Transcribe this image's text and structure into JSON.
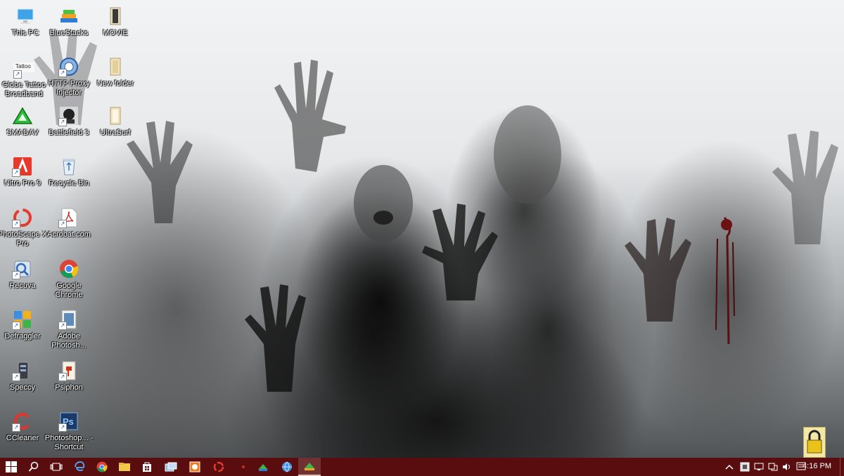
{
  "desktop": {
    "icons": [
      {
        "id": "this-pc",
        "label": "This PC",
        "icon": "monitor-icon"
      },
      {
        "id": "globe-tattoo",
        "label": "Globe Tattoo Broadband",
        "icon": "tattoo-icon",
        "badge": "Tattoo"
      },
      {
        "id": "smadav",
        "label": "SMADAV",
        "icon": "smadav-icon"
      },
      {
        "id": "nitro",
        "label": "Nitro Pro 9",
        "icon": "nitro-icon"
      },
      {
        "id": "photoscape",
        "label": "PhotoScape X Pro",
        "icon": "photoscape-icon"
      },
      {
        "id": "recuva",
        "label": "Recuva",
        "icon": "recuva-icon"
      },
      {
        "id": "defraggler",
        "label": "Defraggler",
        "icon": "defraggler-icon"
      },
      {
        "id": "speccy",
        "label": "Speccy",
        "icon": "speccy-icon"
      },
      {
        "id": "ccleaner",
        "label": "CCleaner",
        "icon": "ccleaner-icon"
      },
      {
        "id": "bluestacks",
        "label": "BlueStacks",
        "icon": "bluestacks-icon"
      },
      {
        "id": "http-proxy",
        "label": "HTTP Proxy Injector",
        "icon": "proxy-injector-icon"
      },
      {
        "id": "battlefield",
        "label": "Battlefield 3",
        "icon": "battlefield-icon"
      },
      {
        "id": "recycle-bin",
        "label": "Recycle Bin",
        "icon": "recycle-bin-icon"
      },
      {
        "id": "acrobat",
        "label": "Acrobat.com",
        "icon": "acrobat-icon"
      },
      {
        "id": "chrome",
        "label": "Google Chrome",
        "icon": "chrome-icon"
      },
      {
        "id": "adobe-photoshop",
        "label": "Adobe Photosh...",
        "icon": "photoshop-icon"
      },
      {
        "id": "psiphon",
        "label": "Psiphon",
        "icon": "psiphon-icon"
      },
      {
        "id": "photoshop-shortcut",
        "label": "Photoshop... - Shortcut",
        "icon": "photoshop-ps-icon"
      },
      {
        "id": "movie",
        "label": "MOVIE",
        "icon": "folder-icon"
      },
      {
        "id": "new-folder",
        "label": "New folder",
        "icon": "folder-icon"
      },
      {
        "id": "ultrasurf",
        "label": "UltraSurf",
        "icon": "ultrasurf-icon"
      }
    ]
  },
  "taskbar": {
    "buttons": [
      {
        "id": "start",
        "icon": "windows-logo-icon"
      },
      {
        "id": "search",
        "icon": "search-icon"
      },
      {
        "id": "task-view",
        "icon": "task-view-icon"
      },
      {
        "id": "edge",
        "icon": "edge-icon"
      },
      {
        "id": "chrome",
        "icon": "chrome-icon"
      },
      {
        "id": "explorer",
        "icon": "file-explorer-icon"
      },
      {
        "id": "store",
        "icon": "store-icon"
      },
      {
        "id": "app1",
        "icon": "app-window-icon"
      },
      {
        "id": "app2",
        "icon": "app-orange-icon"
      },
      {
        "id": "app3",
        "icon": "app-ring-icon"
      },
      {
        "id": "app4",
        "icon": "app-dot-icon"
      },
      {
        "id": "app5",
        "icon": "app-green-icon"
      },
      {
        "id": "app6",
        "icon": "app-globe-icon"
      },
      {
        "id": "app7",
        "icon": "app-active-icon"
      }
    ],
    "tray": [
      "chevron-up-icon",
      "app-tray-icon",
      "network-icon",
      "people-icon",
      "volume-icon",
      "notification-icon"
    ],
    "clock": "4:16 PM"
  },
  "colors": {
    "taskbar": "#5a0d0e"
  }
}
